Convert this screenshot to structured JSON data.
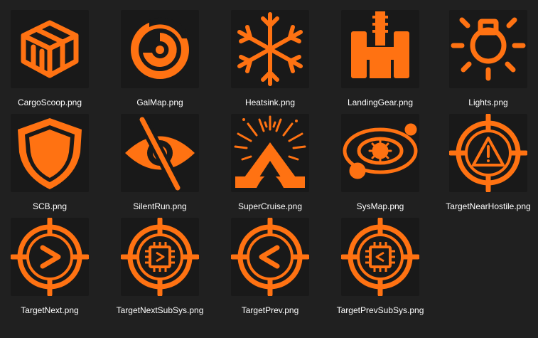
{
  "colors": {
    "background": "#202020",
    "icon_bg": "#191919",
    "icon": "#ff7212",
    "text": "#ffffff"
  },
  "files": [
    {
      "name": "CargoScoop.png",
      "icon": "cargo-crate-icon"
    },
    {
      "name": "GalMap.png",
      "icon": "galaxy-spiral-icon"
    },
    {
      "name": "Heatsink.png",
      "icon": "snowflake-icon"
    },
    {
      "name": "LandingGear.png",
      "icon": "landing-gear-icon"
    },
    {
      "name": "Lights.png",
      "icon": "light-bulb-icon"
    },
    {
      "name": "SCB.png",
      "icon": "shield-icon"
    },
    {
      "name": "SilentRun.png",
      "icon": "eye-slash-icon"
    },
    {
      "name": "SuperCruise.png",
      "icon": "supercruise-icon"
    },
    {
      "name": "SysMap.png",
      "icon": "system-map-icon"
    },
    {
      "name": "TargetNearHostile.png",
      "icon": "target-warning-icon"
    },
    {
      "name": "TargetNext.png",
      "icon": "target-next-icon"
    },
    {
      "name": "TargetNextSubSys.png",
      "icon": "target-next-subsystem-icon"
    },
    {
      "name": "TargetPrev.png",
      "icon": "target-prev-icon"
    },
    {
      "name": "TargetPrevSubSys.png",
      "icon": "target-prev-subsystem-icon"
    }
  ]
}
